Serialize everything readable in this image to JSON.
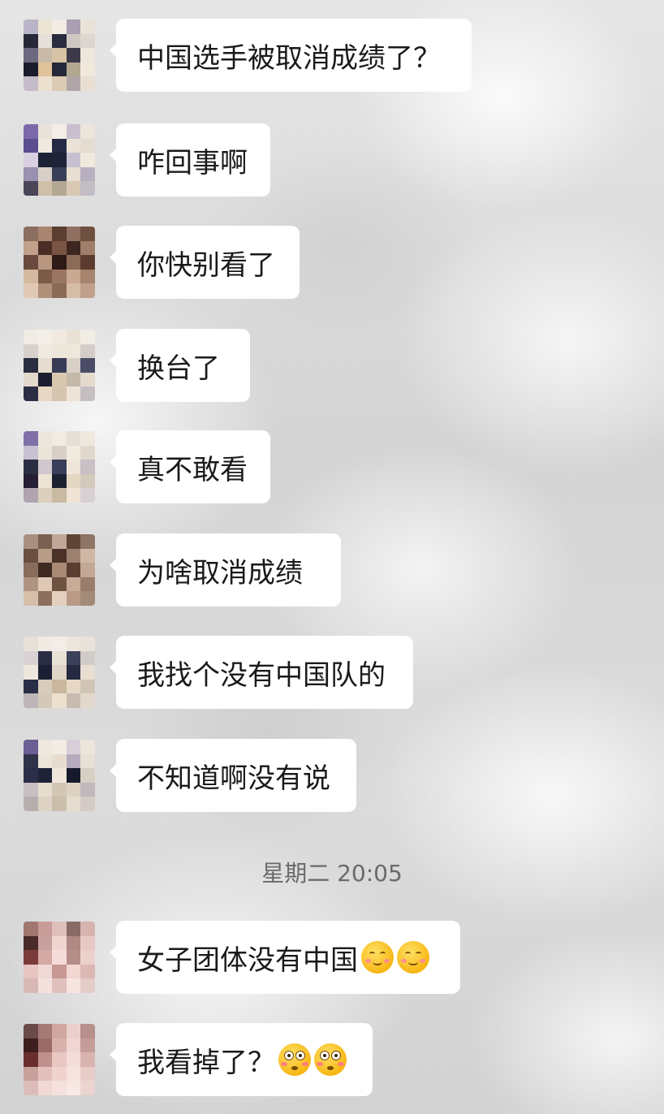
{
  "chat": {
    "timestamp": "星期二 20:05",
    "messages": [
      {
        "text": "中国选手被取消成绩了？",
        "emojis": [],
        "avatar": [
          "#b9b4c8",
          "#ece4d4",
          "#f1ece4",
          "#a8a0b0",
          "#e9e2d7",
          "#262838",
          "#e6e0da",
          "#2a2c40",
          "#cfc8c2",
          "#ddd6cf",
          "#6c6880",
          "#c9b9a8",
          "#d7c3a5",
          "#3c3a48",
          "#efe7db",
          "#1a1c2c",
          "#e1c39a",
          "#242838",
          "#b2a892",
          "#f0e8db",
          "#c4bcc8",
          "#ece0cf",
          "#dccbb4",
          "#b0a6a8",
          "#e8dfd2"
        ]
      },
      {
        "text": "咋回事啊",
        "emojis": [],
        "avatar": [
          "#7b68a8",
          "#e8e2da",
          "#f2ede6",
          "#c9c0cf",
          "#ece6dd",
          "#5a4d90",
          "#f0e9e0",
          "#262a44",
          "#eae2d6",
          "#e4dcd0",
          "#d8d0e0",
          "#1c2236",
          "#1d2338",
          "#c6c0d0",
          "#f1e9dd",
          "#9a90b0",
          "#d7cfc8",
          "#3a3f58",
          "#e8dfd2",
          "#b8b0c0",
          "#4a4658",
          "#cfbfa8",
          "#b3a894",
          "#d8c8b4",
          "#c2bcc4"
        ]
      },
      {
        "text": "你快别看了",
        "emojis": [],
        "avatar": [
          "#8a6e60",
          "#a88570",
          "#5a3e30",
          "#8f7060",
          "#6e5040",
          "#c2a08a",
          "#4a2e24",
          "#7a5444",
          "#3e2620",
          "#a07e6a",
          "#6a4a3e",
          "#b89680",
          "#2e1a16",
          "#8c6a58",
          "#5c3c30",
          "#d4b8a0",
          "#7c5a48",
          "#9a7662",
          "#c8a890",
          "#a6846e",
          "#e0c8b4",
          "#b09078",
          "#8a6a56",
          "#d6bca6",
          "#c0a08c"
        ]
      },
      {
        "text": "换台了",
        "emojis": [],
        "avatar": [
          "#f0ebe4",
          "#f3eee7",
          "#efe9e0",
          "#e8e1d6",
          "#f1ece4",
          "#d8d0cc",
          "#f0eae0",
          "#ede6db",
          "#eee7dc",
          "#d4ccc8",
          "#2a2c40",
          "#e6ddd0",
          "#3a3c56",
          "#d8cfc6",
          "#4a4c68",
          "#e2d8cc",
          "#1c1e30",
          "#d8c8b0",
          "#c4b8a8",
          "#e4dace",
          "#2c2e44",
          "#e6d8c4",
          "#d4c4b0",
          "#ede3d6",
          "#c6bfc2"
        ]
      },
      {
        "text": "真不敢看",
        "emojis": [],
        "avatar": [
          "#8070a8",
          "#ede6dc",
          "#f0ebe3",
          "#e6dfd6",
          "#eee8df",
          "#c8c2d4",
          "#ebe4d9",
          "#d8d0c8",
          "#f1eadf",
          "#e0d8cc",
          "#2a2c42",
          "#d0c8cc",
          "#3a3e58",
          "#efe6da",
          "#c8c0c4",
          "#241f34",
          "#ede4d6",
          "#1c2030",
          "#e3d6c2",
          "#d4cabc",
          "#b0a4b0",
          "#dccfbd",
          "#c9baa2",
          "#efe4d5",
          "#d8d0d4"
        ]
      },
      {
        "text": "为啥取消成绩",
        "emojis": [],
        "avatar": [
          "#a89080",
          "#7a6050",
          "#c0a898",
          "#5c4436",
          "#8e7464",
          "#6a4e40",
          "#b89c88",
          "#4a3228",
          "#9c8070",
          "#d0b8a4",
          "#8a6c5c",
          "#3e2a22",
          "#a88a76",
          "#5a3e32",
          "#c4a896",
          "#b09482",
          "#e0c8b6",
          "#6e5242",
          "#c8ac98",
          "#9a7c6a",
          "#d6bea8",
          "#8c6e5c",
          "#e4d0be",
          "#b89a86",
          "#a48a78"
        ]
      },
      {
        "text": "我找个没有中国队的",
        "emojis": [],
        "avatar": [
          "#e6e0d8",
          "#efeae2",
          "#f2ede6",
          "#ece6dd",
          "#e8e2da",
          "#d8d2d4",
          "#2a2d44",
          "#e8e1d6",
          "#3c4058",
          "#d2ccc8",
          "#eee7dc",
          "#1c2034",
          "#dfd6c8",
          "#262a40",
          "#e8ded2",
          "#2a2e46",
          "#d8ccbc",
          "#c9b89e",
          "#e6d8c4",
          "#d0c4b4",
          "#bdb5b8",
          "#d4c8b8",
          "#ece0ce",
          "#c8bcb0",
          "#e2d8cc"
        ]
      },
      {
        "text": "不知道啊没有说",
        "emojis": [],
        "avatar": [
          "#6a5e94",
          "#eee8df",
          "#f1ece4",
          "#d6cfd8",
          "#ebe5dc",
          "#30324a",
          "#ece5d9",
          "#e6ddd0",
          "#b4acbc",
          "#e8e0d4",
          "#2a2e48",
          "#1e2236",
          "#efe7db",
          "#161a2a",
          "#d8cfc4",
          "#c8bfc2",
          "#e6dccd",
          "#d2c6b4",
          "#ddd2c2",
          "#c0b8bc",
          "#b7aeb0",
          "#ddd2c3",
          "#cbbfac",
          "#e6dccf",
          "#d4cbc6"
        ]
      },
      {
        "text": "女子团体没有中国",
        "emojis": [
          "smile",
          "smile"
        ],
        "avatar": [
          "#a07870",
          "#c89c98",
          "#e0c0bc",
          "#8a6a66",
          "#d8b4b0",
          "#4a2a28",
          "#c8a0a0",
          "#f0d4d0",
          "#b08884",
          "#e8c8c4",
          "#7a3c3a",
          "#d4a8a4",
          "#f4dcd8",
          "#b48c88",
          "#ecd0cc",
          "#e8c4c0",
          "#f0d8d4",
          "#c89894",
          "#f2d6d2",
          "#dcb8b4",
          "#d8b8b4",
          "#f4e0dc",
          "#e0c0bc",
          "#f6e4e0",
          "#e4ccc8"
        ]
      },
      {
        "text": "我看掉了？",
        "emojis": [
          "flushed",
          "flushed"
        ],
        "avatar": [
          "#6a4a48",
          "#a47a76",
          "#cfa6a2",
          "#ead0cc",
          "#b8908c",
          "#3c1e1e",
          "#9a6a66",
          "#d8b0ac",
          "#f0d6d2",
          "#c49c98",
          "#6a2e2e",
          "#c0908c",
          "#e8c6c2",
          "#f4dcd8",
          "#d8b4b0",
          "#c8a09c",
          "#e4c0bc",
          "#f0d2ce",
          "#f6e2de",
          "#e8ccc8",
          "#dcbcb8",
          "#f0d8d4",
          "#f4e0dc",
          "#f8e8e4",
          "#ecd4d0"
        ]
      }
    ]
  }
}
